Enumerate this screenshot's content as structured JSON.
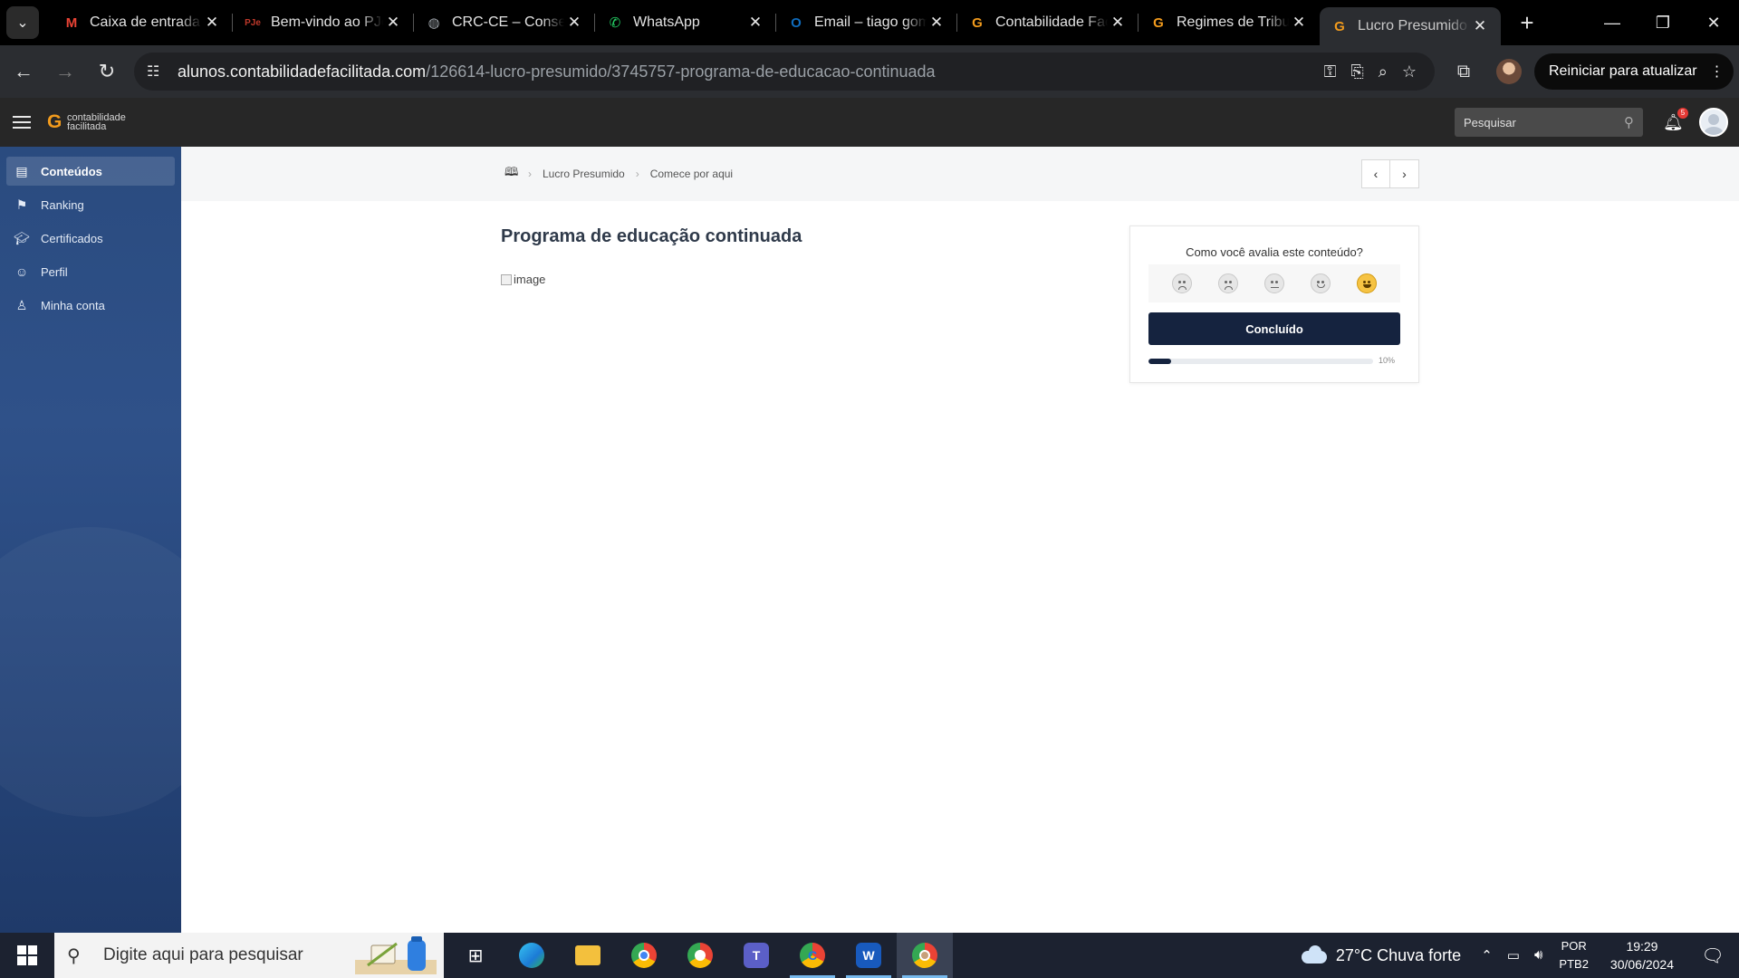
{
  "browser": {
    "tabs": [
      {
        "title": "Caixa de entrada",
        "favicon": "gmail-icon",
        "favicon_text": "M",
        "color": "#ea4335"
      },
      {
        "title": "Bem-vindo ao PJe",
        "favicon": "pje-icon",
        "favicon_text": "PJe",
        "color": "#c0392b"
      },
      {
        "title": "CRC-CE – Conselho",
        "favicon": "globe-icon",
        "favicon_text": "◍",
        "color": "#9aa0a6"
      },
      {
        "title": "WhatsApp",
        "favicon": "whatsapp-icon",
        "favicon_text": "✆",
        "color": "#25d366"
      },
      {
        "title": "Email – tiago gomes",
        "favicon": "outlook-icon",
        "favicon_text": "O",
        "color": "#0f6cbd"
      },
      {
        "title": "Contabilidade Facilitada",
        "favicon": "contabilidade-icon",
        "favicon_text": "G",
        "color": "#f29b1d"
      },
      {
        "title": "Regimes de Tributação",
        "favicon": "contabilidade-icon",
        "favicon_text": "G",
        "color": "#f29b1d"
      },
      {
        "title": "Lucro Presumido",
        "favicon": "contabilidade-icon",
        "favicon_text": "G",
        "color": "#f29b1d",
        "active": true
      }
    ],
    "url_host": "alunos.contabilidadefacilitada.com",
    "url_path": "/126614-lucro-presumido/3745757-programa-de-educacao-continuada",
    "restart_label": "Reiniciar para atualizar"
  },
  "header": {
    "logo_line1": "contabilidade",
    "logo_line2": "facilitada",
    "search_placeholder": "Pesquisar",
    "notification_count": "5"
  },
  "sidebar": {
    "items": [
      {
        "label": "Conteúdos",
        "icon": "book-icon",
        "active": true
      },
      {
        "label": "Ranking",
        "icon": "flag-icon"
      },
      {
        "label": "Certificados",
        "icon": "graduation-cap-icon"
      },
      {
        "label": "Perfil",
        "icon": "smile-icon"
      },
      {
        "label": "Minha conta",
        "icon": "user-icon"
      }
    ]
  },
  "breadcrumb": {
    "items": [
      "Lucro Presumido",
      "Comece por aqui"
    ]
  },
  "main": {
    "title": "Programa de educação continuada",
    "image_alt": "image"
  },
  "rating": {
    "question": "Como você avalia este conteúdo?",
    "emojis": [
      "angry-face-icon",
      "sad-face-icon",
      "neutral-face-icon",
      "slight-smile-icon",
      "happy-face-icon"
    ],
    "done_label": "Concluído",
    "progress_percent": 10,
    "progress_label": "10%"
  },
  "taskbar": {
    "search_text": "Digite aqui para pesquisar",
    "weather": "27°C  Chuva forte",
    "lang_line1": "POR",
    "lang_line2": "PTB2",
    "time": "19:29",
    "date": "30/06/2024"
  }
}
